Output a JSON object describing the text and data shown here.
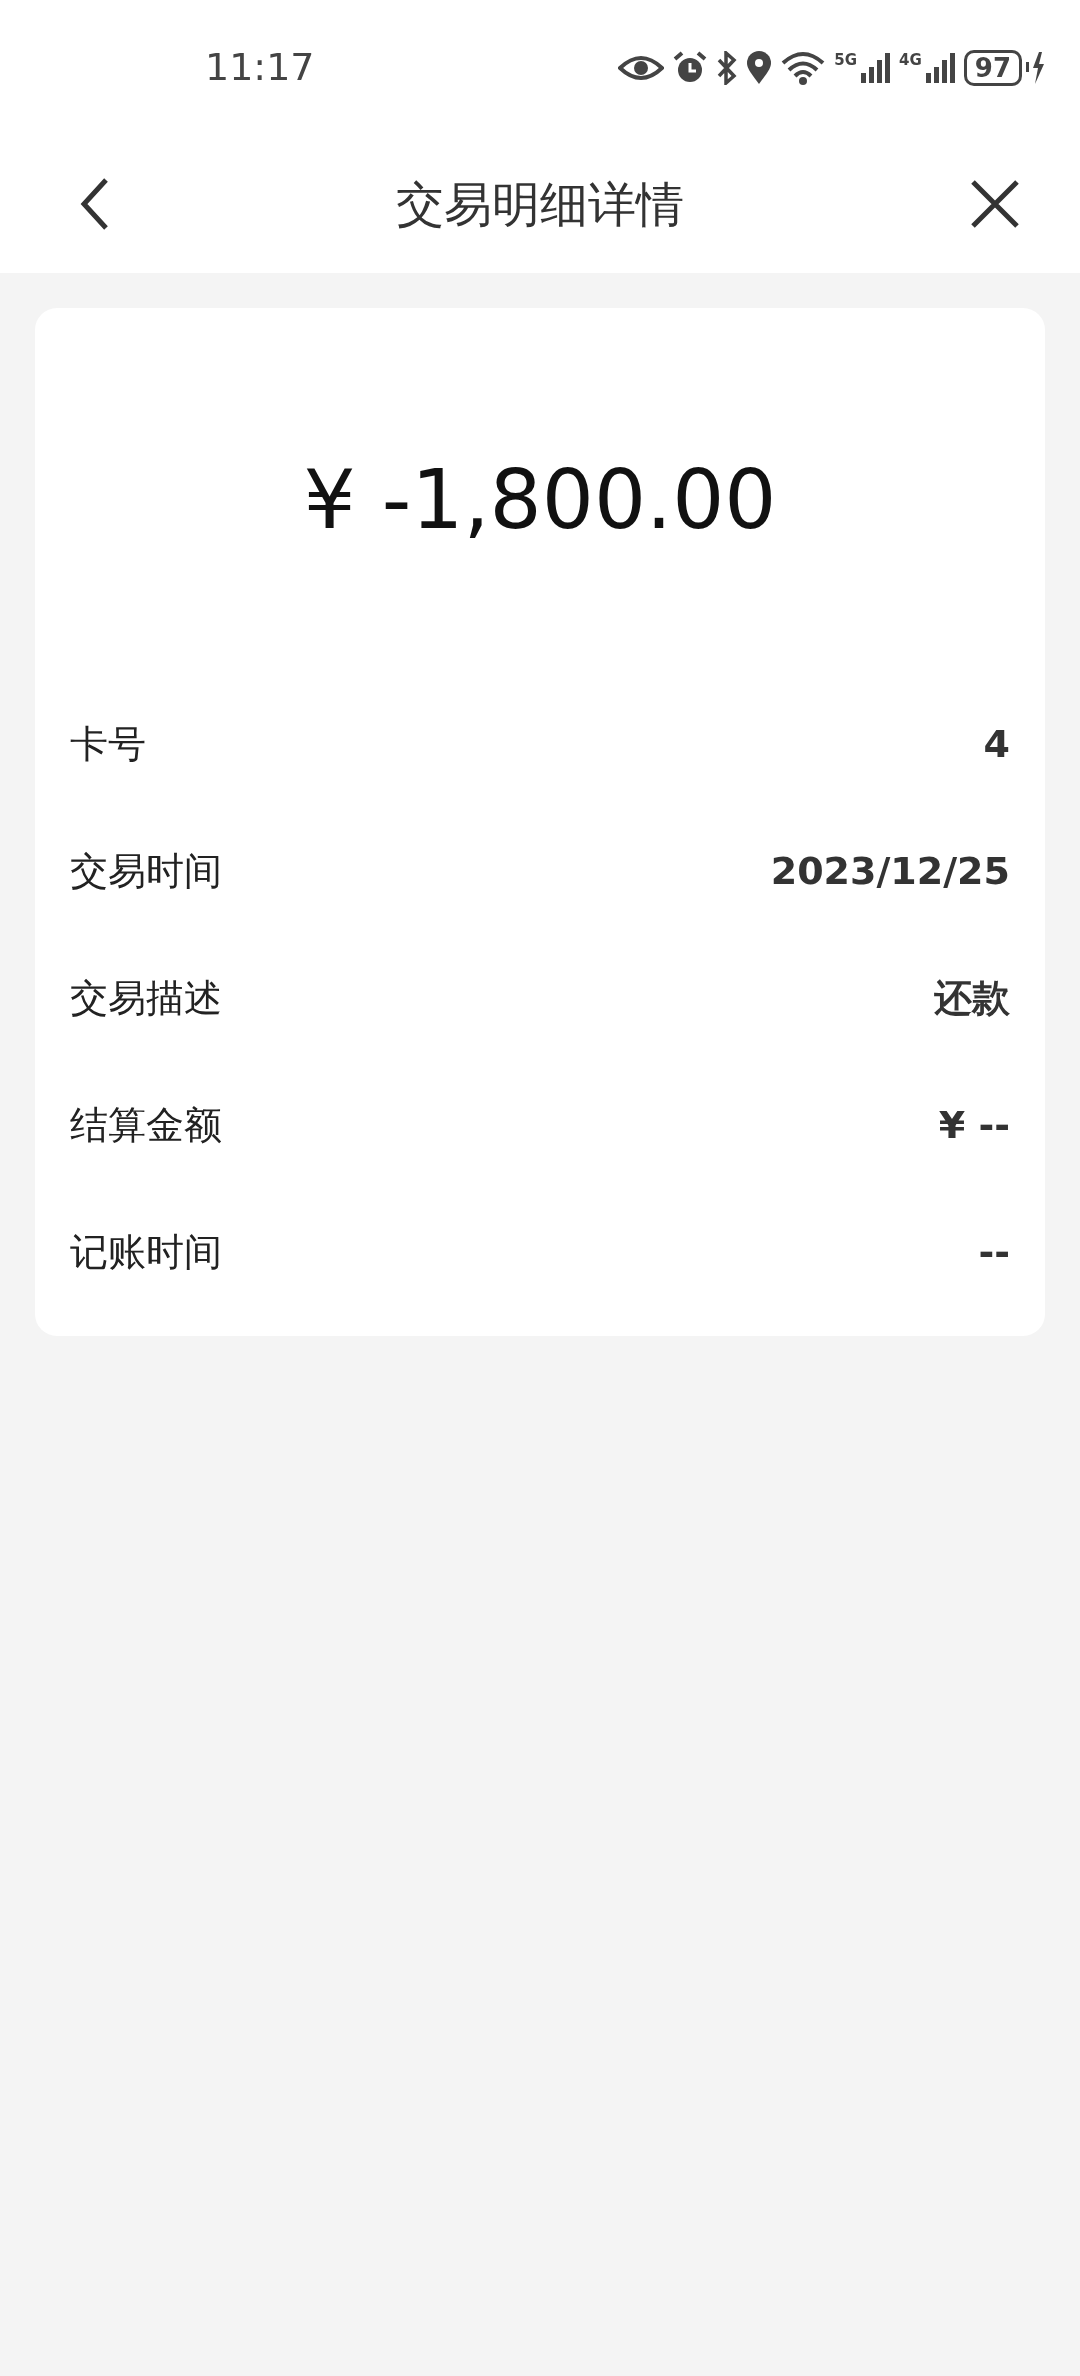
{
  "status_bar": {
    "time": "11:17",
    "network_labels": [
      "5G",
      "4G"
    ],
    "battery": "97"
  },
  "header": {
    "title": "交易明细详情"
  },
  "amount": "¥ -1,800.00",
  "details": [
    {
      "label": "卡号",
      "value": "4"
    },
    {
      "label": "交易时间",
      "value": "2023/12/25"
    },
    {
      "label": "交易描述",
      "value": "还款"
    },
    {
      "label": "结算金额",
      "value": "¥ --"
    },
    {
      "label": "记账时间",
      "value": "--"
    }
  ]
}
